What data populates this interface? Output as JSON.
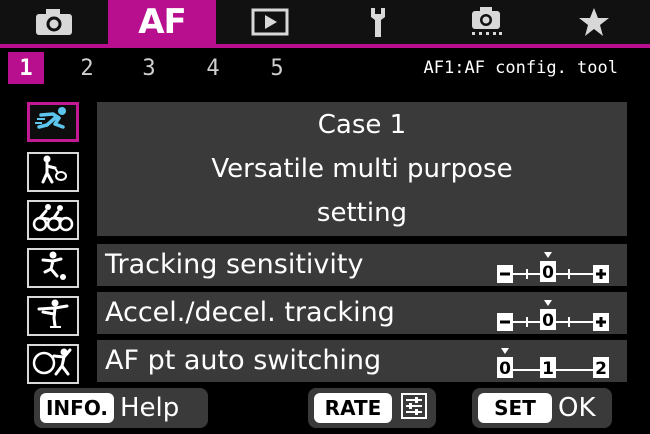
{
  "tabs": [
    {
      "icon": "camera-icon"
    },
    {
      "label": "AF",
      "active": true
    },
    {
      "icon": "playback-icon"
    },
    {
      "icon": "wrench-icon"
    },
    {
      "icon": "custom-functions-icon"
    },
    {
      "icon": "star-icon"
    }
  ],
  "pages": [
    "1",
    "2",
    "3",
    "4",
    "5"
  ],
  "active_page": "1",
  "menu_title": "AF1:AF config. tool",
  "case_icons": [
    {
      "icon": "runner-icon",
      "selected": true
    },
    {
      "icon": "tennis-player-icon"
    },
    {
      "icon": "cyclists-icon"
    },
    {
      "icon": "soccer-player-icon"
    },
    {
      "icon": "skater-icon"
    },
    {
      "icon": "gymnast-icon"
    }
  ],
  "case": {
    "line1": "Case 1",
    "line2": "Versatile multi purpose",
    "line3": "setting"
  },
  "params": [
    {
      "label": "Tracking sensitivity",
      "scale": [
        "−",
        "0",
        "+"
      ],
      "level": 0
    },
    {
      "label": "Accel./decel. tracking",
      "scale": [
        "−",
        "0",
        "+"
      ],
      "level": 0
    },
    {
      "label": "AF pt auto switching",
      "scale": [
        "0",
        "1",
        "2"
      ],
      "level": 0
    }
  ],
  "buttons": {
    "info_key": "INFO.",
    "help": "Help",
    "rate_key": "RATE",
    "set_key": "SET",
    "ok": "OK"
  },
  "colors": {
    "accent": "#b80f8f",
    "panel": "#3a3a3a",
    "background": "#000000"
  }
}
